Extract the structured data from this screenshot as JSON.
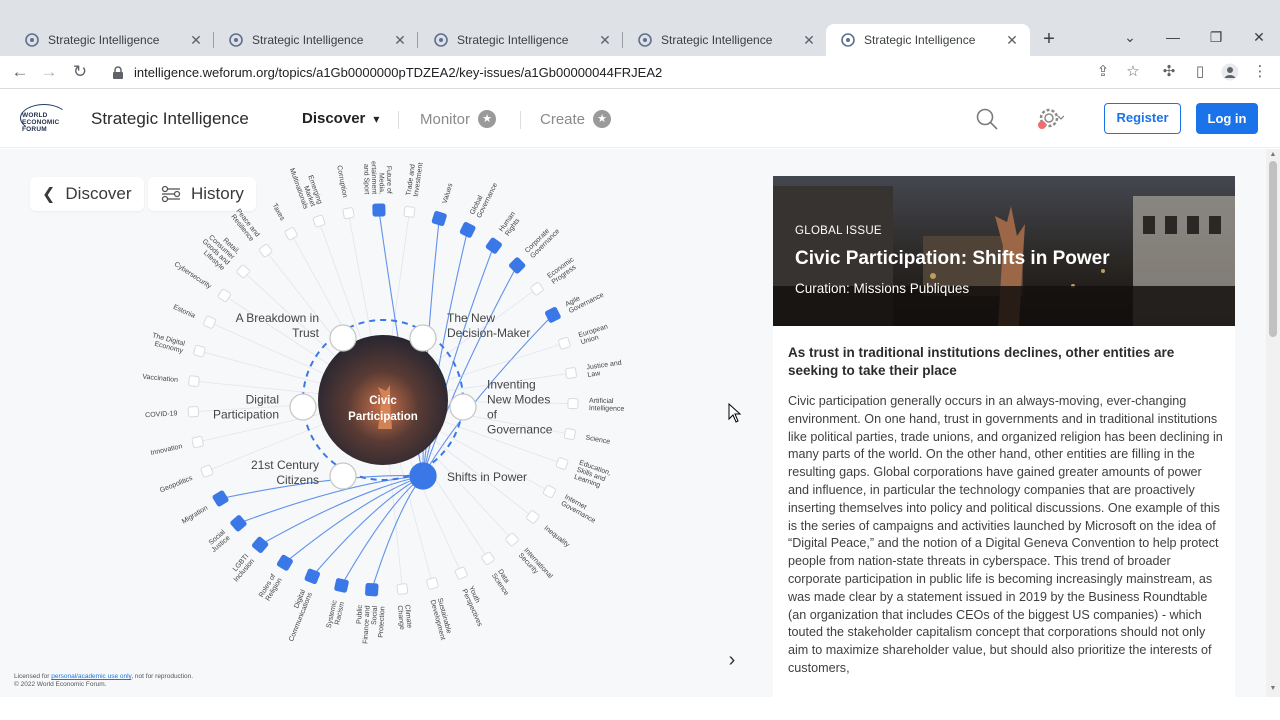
{
  "browser": {
    "tabs": [
      {
        "title": "Strategic Intelligence",
        "active": false
      },
      {
        "title": "Strategic Intelligence",
        "active": false
      },
      {
        "title": "Strategic Intelligence",
        "active": false
      },
      {
        "title": "Strategic Intelligence",
        "active": false
      },
      {
        "title": "Strategic Intelligence",
        "active": true
      }
    ],
    "url": "intelligence.weforum.org/topics/a1Gb0000000pTDZEA2/key-issues/a1Gb00000044FRJEA2"
  },
  "header": {
    "logo_lines": [
      "WORLD",
      "ECONOMIC",
      "FORUM"
    ],
    "site_title": "Strategic Intelligence",
    "nav": {
      "discover": "Discover",
      "monitor": "Monitor",
      "create": "Create"
    },
    "register": "Register",
    "login": "Log in"
  },
  "main": {
    "back_label": "Discover",
    "history_label": "History",
    "license_prefix": "Licensed for ",
    "license_link": "personal/academic use only",
    "license_suffix": ", not for reproduction.",
    "copyright": "© 2022 World Economic Forum."
  },
  "visualization": {
    "center_label_line1": "Civic",
    "center_label_line2": "Participation",
    "accent_color": "#3b78e7",
    "key_issues": [
      {
        "lines": [
          "A Breakdown in",
          "Trust"
        ],
        "selected": false
      },
      {
        "lines": [
          "The New",
          "Decision-Maker"
        ],
        "selected": false
      },
      {
        "lines": [
          "Inventing",
          "New Modes",
          "of",
          "Governance"
        ],
        "selected": false
      },
      {
        "lines": [
          "Shifts in Power"
        ],
        "selected": true
      },
      {
        "lines": [
          "21st Century",
          "Citizens"
        ],
        "selected": false
      },
      {
        "lines": [
          "Digital",
          "Participation"
        ],
        "selected": false
      }
    ],
    "topics": [
      {
        "lines": [
          "Trade and",
          "Investment"
        ],
        "highlight": false
      },
      {
        "lines": [
          "Values"
        ],
        "highlight": true
      },
      {
        "lines": [
          "Global",
          "Governance"
        ],
        "highlight": true
      },
      {
        "lines": [
          "Human",
          "Rights"
        ],
        "highlight": true
      },
      {
        "lines": [
          "Corporate",
          "Governance"
        ],
        "highlight": true
      },
      {
        "lines": [
          "Economic",
          "Progress"
        ],
        "highlight": false
      },
      {
        "lines": [
          "Agile",
          "Governance"
        ],
        "highlight": true
      },
      {
        "lines": [
          "European",
          "Union"
        ],
        "highlight": false
      },
      {
        "lines": [
          "Justice and",
          "Law"
        ],
        "highlight": false
      },
      {
        "lines": [
          "Artificial",
          "Intelligence"
        ],
        "highlight": false
      },
      {
        "lines": [
          "Science"
        ],
        "highlight": false
      },
      {
        "lines": [
          "Education,",
          "Skills and",
          "Learning"
        ],
        "highlight": false
      },
      {
        "lines": [
          "Internet",
          "Governance"
        ],
        "highlight": false
      },
      {
        "lines": [
          "Inequality"
        ],
        "highlight": false
      },
      {
        "lines": [
          "International",
          "Security"
        ],
        "highlight": false
      },
      {
        "lines": [
          "Data",
          "Science"
        ],
        "highlight": false
      },
      {
        "lines": [
          "Youth",
          "Perspectives"
        ],
        "highlight": false
      },
      {
        "lines": [
          "Sustainable",
          "Development"
        ],
        "highlight": false
      },
      {
        "lines": [
          "Climate",
          "Change"
        ],
        "highlight": false
      },
      {
        "lines": [
          "Public",
          "Finance and",
          "Social",
          "Protection"
        ],
        "highlight": true
      },
      {
        "lines": [
          "Systemic",
          "Racism"
        ],
        "highlight": true
      },
      {
        "lines": [
          "Digital",
          "Communications"
        ],
        "highlight": true
      },
      {
        "lines": [
          "Roles of",
          "Religion"
        ],
        "highlight": true
      },
      {
        "lines": [
          "LGBTI",
          "Inclusion"
        ],
        "highlight": true
      },
      {
        "lines": [
          "Social",
          "Justice"
        ],
        "highlight": true
      },
      {
        "lines": [
          "Migration"
        ],
        "highlight": true
      },
      {
        "lines": [
          "Geopolitics"
        ],
        "highlight": false
      },
      {
        "lines": [
          "Innovation"
        ],
        "highlight": false
      },
      {
        "lines": [
          "COVID-19"
        ],
        "highlight": false
      },
      {
        "lines": [
          "Vaccination"
        ],
        "highlight": false
      },
      {
        "lines": [
          "The Digital",
          "Economy"
        ],
        "highlight": false
      },
      {
        "lines": [
          "Estonia"
        ],
        "highlight": false
      },
      {
        "lines": [
          "Cybersecurity"
        ],
        "highlight": false
      },
      {
        "lines": [
          "Retail,",
          "Consumer",
          "Goods and",
          "Lifestyle"
        ],
        "highlight": false
      },
      {
        "lines": [
          "Peace and",
          "Resilience"
        ],
        "highlight": false
      },
      {
        "lines": [
          "Taxes"
        ],
        "highlight": false
      },
      {
        "lines": [
          "Emerging",
          "Market",
          "Multinationals"
        ],
        "highlight": false
      },
      {
        "lines": [
          "Corruption"
        ],
        "highlight": false
      },
      {
        "lines": [
          "Future of",
          "Media,",
          "Entertainment",
          "and Sport"
        ],
        "highlight": true
      }
    ]
  },
  "panel": {
    "label": "GLOBAL ISSUE",
    "title": "Civic Participation: Shifts in Power",
    "curation": "Curation: Missions Publiques",
    "subtitle": "As trust in traditional institutions declines, other entities are seeking to take their place",
    "body": "Civic participation generally occurs in an always-moving, ever-changing environment. On one hand, trust in governments and in traditional institutions like political parties, trade unions, and organized religion has been declining in many parts of the world. On the other hand, other entities are filling in the resulting gaps. Global corporations have gained greater amounts of power and influence, in particular the technology companies that are proactively inserting themselves into policy and political discussions. One example of this is the series of campaigns and activities launched by Microsoft on the idea of “Digital Peace,” and the notion of a Digital Geneva Convention to help protect people from nation-state threats in cyberspace. This trend of broader corporate participation in public life is becoming increasingly mainstream, as was made clear by a statement issued in 2019 by the Business Roundtable (an organization that includes CEOs of the biggest US companies) - which touted the stakeholder capitalism concept that corporations should not only aim to maximize shareholder value, but should also prioritize the interests of customers,"
  }
}
